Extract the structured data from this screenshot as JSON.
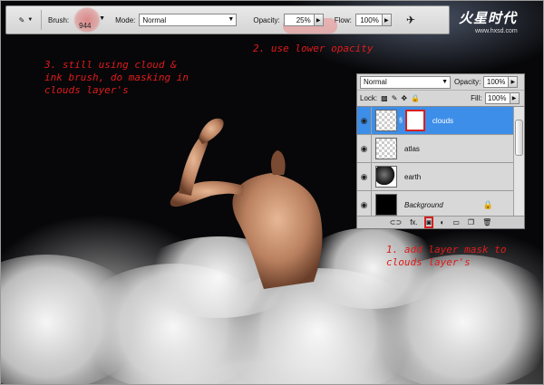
{
  "options_bar": {
    "brush_label": "Brush:",
    "brush_size": "944",
    "mode_label": "Mode:",
    "mode_value": "Normal",
    "opacity_label": "Opacity:",
    "opacity_value": "25%",
    "flow_label": "Flow:",
    "flow_value": "100%"
  },
  "logo": {
    "main": "火星时代",
    "url": "www.hxsd.com"
  },
  "annotations": {
    "step1": [
      "1. add layer mask to",
      "clouds layer's"
    ],
    "step2": "2. use lower opacity",
    "step3": [
      "3. still using cloud &",
      "ink brush, do masking in",
      "clouds layer's"
    ]
  },
  "layers_panel": {
    "blend_mode": "Normal",
    "opacity_label": "Opacity:",
    "opacity_value": "100%",
    "lock_label": "Lock:",
    "fill_label": "Fill:",
    "fill_value": "100%",
    "layers": [
      {
        "name": "clouds",
        "active": true
      },
      {
        "name": "atlas",
        "active": false
      },
      {
        "name": "earth",
        "active": false
      },
      {
        "name": "Background",
        "active": false
      }
    ],
    "footer_fx": "fx."
  },
  "colors": {
    "annotation": "#e01b1b",
    "active_layer": "#3d8ee8",
    "highlight": "#d42020"
  }
}
